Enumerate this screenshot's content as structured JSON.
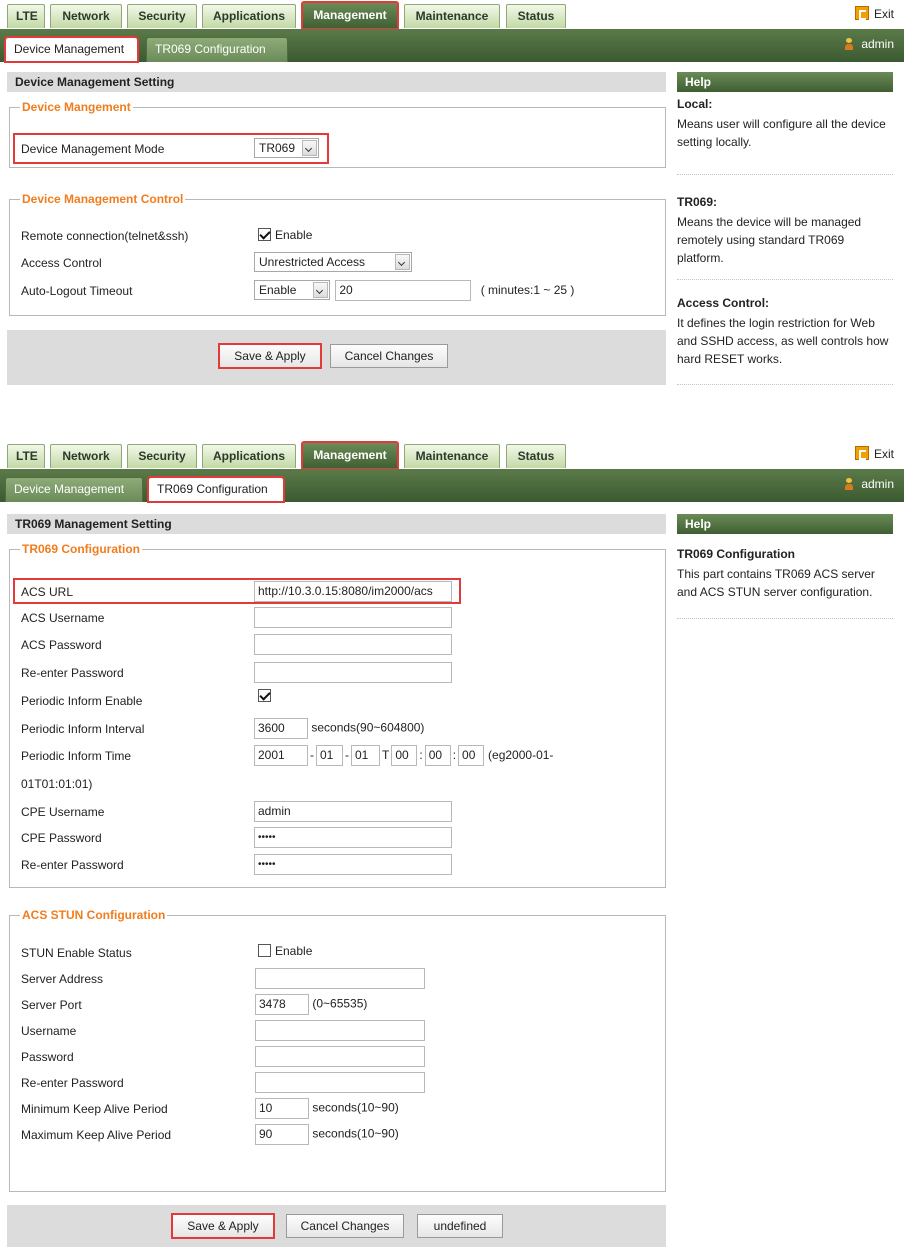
{
  "tabs": [
    "LTE",
    "Network",
    "Security",
    "Applications",
    "Management",
    "Maintenance",
    "Status"
  ],
  "exit_label": "Exit",
  "subtabs": [
    "Device Management",
    "TR069 Configuration"
  ],
  "user": "admin",
  "help_title": "Help",
  "panel1": {
    "section_title": "Device Management Setting",
    "fs1_legend": "Device Mangement",
    "mode_label": "Device Management Mode",
    "mode_value": "TR069",
    "fs2_legend": "Device Management Control",
    "remote_label": "Remote connection(telnet&ssh)",
    "remote_checkbox_label": "Enable",
    "remote_checked": true,
    "access_label": "Access Control",
    "access_value": "Unrestricted Access",
    "autologout_label": "Auto-Logout Timeout",
    "autologout_select": "Enable",
    "autologout_value": "20",
    "autologout_hint": "( minutes:1 ~ 25 )",
    "save_button": "Save & Apply",
    "cancel_button": "Cancel Changes",
    "help": [
      {
        "title": "Local:",
        "text": "Means user will configure all the device setting locally."
      },
      {
        "title": "TR069:",
        "text": "Means the device will be managed remotely using standard TR069 platform."
      },
      {
        "title": "Access Control:",
        "text": "It defines the login restriction for Web and SSHD access, as well controls how hard RESET works."
      }
    ]
  },
  "panel2": {
    "section_title": "TR069 Management Setting",
    "fs1_legend": "TR069 Configuration",
    "acs_url_label": "ACS URL",
    "acs_url_value": "http://10.3.0.15:8080/im2000/acs",
    "acs_username_label": "ACS Username",
    "acs_username_value": "",
    "acs_password_label": "ACS Password",
    "acs_password_value": "",
    "reenter1_label": "Re-enter Password",
    "reenter1_value": "",
    "periodic_enable_label": "Periodic Inform Enable",
    "periodic_enable_checked": true,
    "periodic_interval_label": "Periodic Inform Interval",
    "periodic_interval_value": "3600",
    "periodic_interval_hint": "seconds(90~604800)",
    "periodic_time_label": "Periodic Inform Time",
    "time_year": "2001",
    "time_month": "01",
    "time_day": "01",
    "time_hour": "00",
    "time_min": "00",
    "time_sec": "00",
    "sep_dash": "-",
    "sep_t": "T",
    "sep_colon": ":",
    "time_hint": "(eg2000-01-",
    "time_hint_cont": "01T01:01:01)",
    "cpe_username_label": "CPE Username",
    "cpe_username_value": "admin",
    "cpe_password_label": "CPE Password",
    "cpe_password_value": "•••••",
    "reenter2_label": "Re-enter Password",
    "reenter2_value": "•••••",
    "fs2_legend": "ACS STUN Configuration",
    "stun_enable_label": "STUN Enable Status",
    "stun_checkbox_label": "Enable",
    "stun_checked": false,
    "server_address_label": "Server Address",
    "server_address_value": "",
    "server_port_label": "Server Port",
    "server_port_value": "3478",
    "server_port_hint": "(0~65535)",
    "username_label": "Username",
    "username_value": "",
    "password_label": "Password",
    "password_value": "",
    "reenter3_label": "Re-enter Password",
    "reenter3_value": "",
    "min_keep_label": "Minimum Keep Alive Period",
    "min_keep_value": "10",
    "min_keep_hint": "seconds(10~90)",
    "max_keep_label": "Maximum Keep Alive Period",
    "max_keep_value": "90",
    "max_keep_hint": "seconds(10~90)",
    "save_button": "Save & Apply",
    "cancel_button": "Cancel Changes",
    "extra_button": "undefined",
    "help": [
      {
        "title": "TR069 Configuration",
        "text": "This part contains TR069 ACS server and ACS STUN server configuration."
      }
    ]
  },
  "colors": {
    "accent_green": "#4a6b3c",
    "legend_orange": "#f07d1e",
    "highlight_red": "#e23a3a"
  }
}
